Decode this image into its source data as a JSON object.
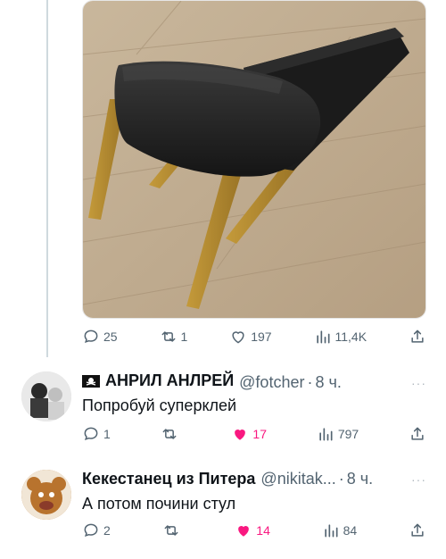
{
  "tweet": {
    "actions": {
      "replies": "25",
      "reposts": "1",
      "likes": "197",
      "views": "11,4K"
    }
  },
  "replies": [
    {
      "name": "АНРИЛ АНЛРЕЙ",
      "handle": "@fotcher",
      "time": "8 ч.",
      "text": "Попробуй суперклей",
      "more": "···",
      "actions": {
        "replies": "1",
        "reposts": "",
        "likes": "17",
        "views": "797"
      },
      "liked": true
    },
    {
      "name": "Кекестанец из Питера",
      "handle": "@nikitak...",
      "time": "8 ч.",
      "text": "А потом почини стул",
      "more": "···",
      "actions": {
        "replies": "2",
        "reposts": "",
        "likes": "14",
        "views": "84"
      },
      "liked": true
    }
  ],
  "colors": {
    "muted": "#536471",
    "like": "#f91880",
    "line": "#cfd9de"
  }
}
